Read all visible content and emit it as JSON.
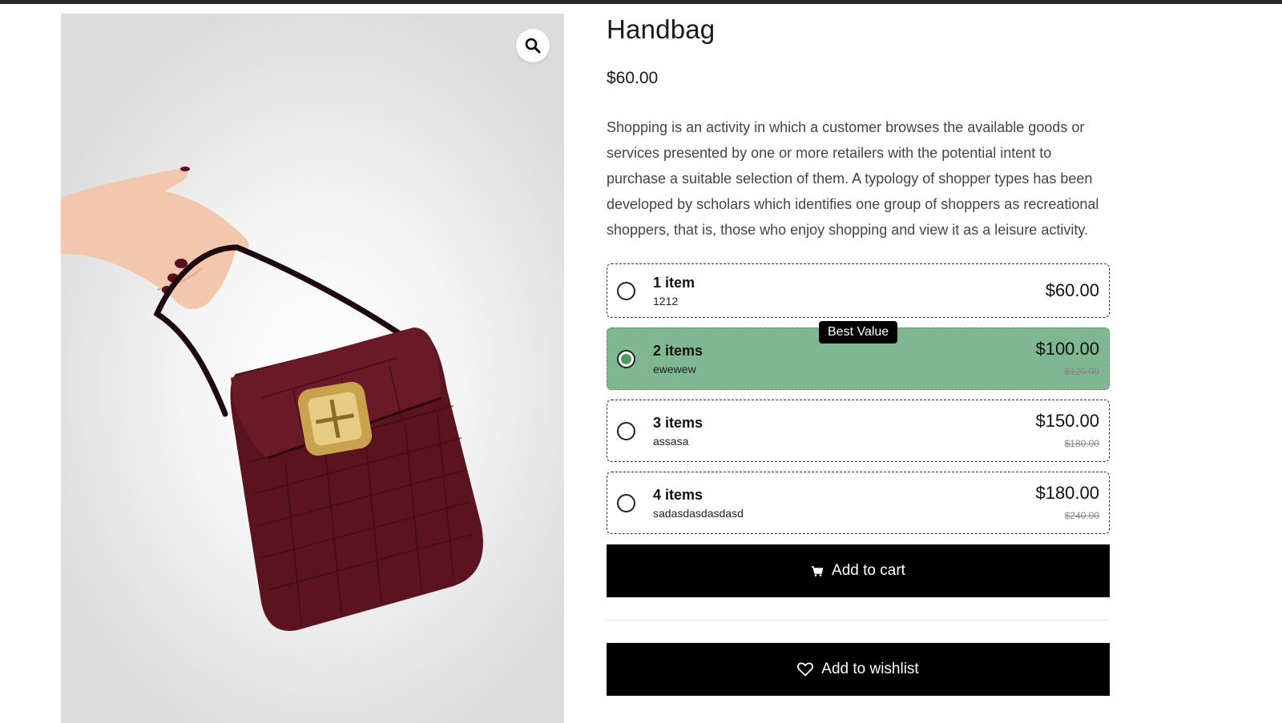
{
  "product": {
    "title": "Handbag",
    "price": "$60.00",
    "description": "Shopping is an activity in which a customer browses the available goods or services presented by one or more retailers with the potential intent to purchase a suitable selection of them. A typology of shopper types has been developed by scholars which identifies one group of shoppers as recreational shoppers, that is, those who enjoy shopping and view it as a leisure activity."
  },
  "gallery": {
    "zoom_icon": "magnifier-icon"
  },
  "bundles": [
    {
      "label": "1 item",
      "sub": "1212",
      "price": "$60.00",
      "old_price": "",
      "selected": false
    },
    {
      "label": "2 items",
      "sub": "ewewew",
      "price": "$100.00",
      "old_price": "$120.00",
      "selected": true,
      "badge": "Best Value"
    },
    {
      "label": "3 items",
      "sub": "assasa",
      "price": "$150.00",
      "old_price": "$180.00",
      "selected": false
    },
    {
      "label": "4 items",
      "sub": "sadasdasdasdasd",
      "price": "$180.00",
      "old_price": "$240.00",
      "selected": false
    }
  ],
  "actions": {
    "add_to_cart": "Add to cart",
    "add_to_cart_icon": "cart-icon",
    "add_to_wishlist": "Add to wishlist",
    "add_to_wishlist_icon": "heart-icon"
  },
  "colors": {
    "selected_bundle": "#7fb890",
    "button": "#000000",
    "top_bar": "#24292d"
  }
}
